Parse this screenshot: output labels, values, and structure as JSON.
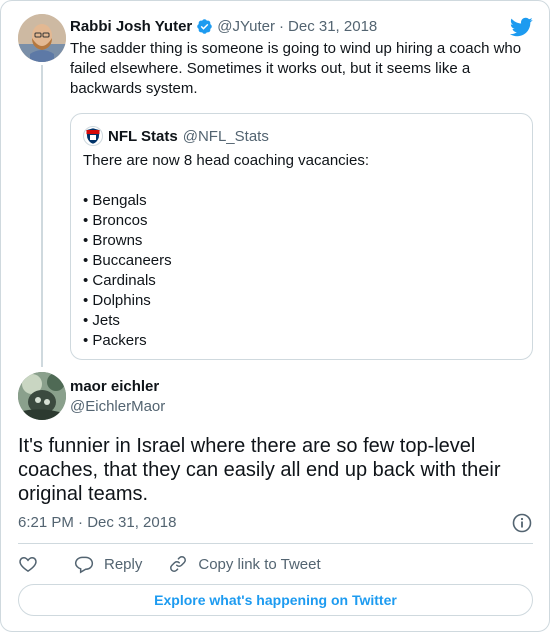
{
  "parent_tweet": {
    "display_name": "Rabbi Josh Yuter",
    "handle": "@JYuter",
    "separator": "·",
    "date": "Dec 31, 2018",
    "text": "The sadder thing is someone is going to wind up hiring a coach who failed elsewhere. Sometimes it works out, but it seems like a backwards system.",
    "verified": true
  },
  "quoted_tweet": {
    "display_name": "NFL Stats",
    "handle": "@NFL_Stats",
    "intro": "There are now 8 head coaching vacancies:",
    "items": [
      "• Bengals",
      "• Broncos",
      "• Browns",
      "• Buccaneers",
      "• Cardinals",
      "• Dolphins",
      "• Jets",
      "• Packers"
    ]
  },
  "main_tweet": {
    "display_name": "maor eichler",
    "handle": "@EichlerMaor",
    "text": "It's funnier in Israel where there are so few top-level coaches, that they can easily all end up back with their original teams.",
    "timestamp": "6:21 PM · Dec 31, 2018"
  },
  "actions": {
    "reply_label": "Reply",
    "copy_link_label": "Copy link to Tweet"
  },
  "explore_label": "Explore what's happening on Twitter",
  "icons": {
    "brand": "twitter-bird-icon",
    "verified": "verified-badge-icon",
    "like": "heart-icon",
    "reply": "reply-bubble-icon",
    "copy_link": "link-icon",
    "info": "info-icon"
  },
  "colors": {
    "accent": "#1d9bf0",
    "text": "#0f1419",
    "secondary_text": "#536471",
    "border": "#cfd9de"
  }
}
